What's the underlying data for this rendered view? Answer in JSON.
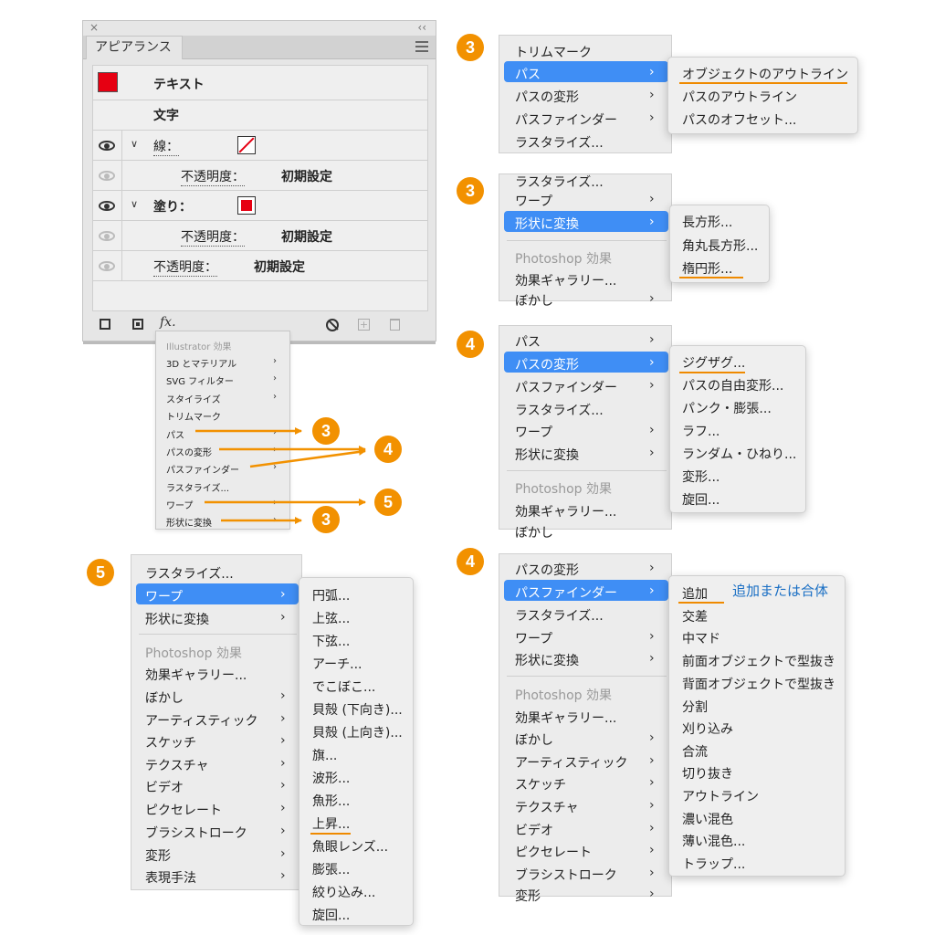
{
  "colors": {
    "accent": "#f29100",
    "highlight": "#3f8ef5",
    "swatch_red": "#e60012",
    "note_blue": "#1a6fc4"
  },
  "panel": {
    "close": "×",
    "collapse": "‹‹",
    "tab": "アピアランス",
    "rows": {
      "title": "テキスト",
      "sub": "文字",
      "stroke_label": "線：",
      "stroke_opacity_label": "不透明度：",
      "stroke_opacity_value": "初期設定",
      "fill_label": "塗り：",
      "fill_opacity_label": "不透明度：",
      "fill_opacity_value": "初期設定",
      "opacity_label": "不透明度：",
      "opacity_value": "初期設定"
    },
    "footer_fx": "fx."
  },
  "fx_menu": {
    "header": "Illustrator 効果",
    "items": [
      "3D とマテリアル",
      "SVG フィルター",
      "スタイライズ",
      "トリムマーク",
      "パス",
      "パスの変形",
      "パスファインダー",
      "ラスタライズ...",
      "ワープ",
      "形状に変換"
    ]
  },
  "badges": {
    "b1": "3",
    "b2": "4",
    "b3": "5",
    "b4": "3",
    "m1": "3",
    "m2": "3",
    "m3": "4",
    "m4": "5",
    "m5": "4"
  },
  "m1": {
    "items": [
      "トリムマーク",
      "パス",
      "パスの変形",
      "パスファインダー",
      "ラスタライズ..."
    ],
    "sub": [
      "オブジェクトのアウトライン",
      "パスのアウトライン",
      "パスのオフセット..."
    ]
  },
  "m2": {
    "items": [
      "ラスタライズ...",
      "ワープ",
      "形状に変換",
      "Photoshop 効果",
      "効果ギャラリー...",
      "ぼかし"
    ],
    "sub": [
      "長方形...",
      "角丸長方形...",
      "楕円形..."
    ]
  },
  "m3": {
    "items": [
      "パス",
      "パスの変形",
      "パスファインダー",
      "ラスタライズ...",
      "ワープ",
      "形状に変換",
      "Photoshop 効果",
      "効果ギャラリー...",
      "ぼかし"
    ],
    "sub": [
      "ジグザグ...",
      "パスの自由変形...",
      "パンク・膨張...",
      "ラフ...",
      "ランダム・ひねり...",
      "変形...",
      "旋回..."
    ]
  },
  "m4": {
    "items": [
      "ラスタライズ...",
      "ワープ",
      "形状に変換",
      "Photoshop 効果",
      "効果ギャラリー...",
      "ぼかし",
      "アーティスティック",
      "スケッチ",
      "テクスチャ",
      "ビデオ",
      "ピクセレート",
      "ブラシストローク",
      "変形",
      "表現手法"
    ],
    "sub": [
      "円弧...",
      "上弦...",
      "下弦...",
      "アーチ...",
      "でこぼこ...",
      "貝殻 (下向き)...",
      "貝殻 (上向き)...",
      "旗...",
      "波形...",
      "魚形...",
      "上昇...",
      "魚眼レンズ...",
      "膨張...",
      "絞り込み...",
      "旋回..."
    ]
  },
  "m5": {
    "items": [
      "パスの変形",
      "パスファインダー",
      "ラスタライズ...",
      "ワープ",
      "形状に変換",
      "Photoshop 効果",
      "効果ギャラリー...",
      "ぼかし",
      "アーティスティック",
      "スケッチ",
      "テクスチャ",
      "ビデオ",
      "ピクセレート",
      "ブラシストローク",
      "変形"
    ],
    "sub": [
      "追加",
      "交差",
      "中マド",
      "前面オブジェクトで型抜き",
      "背面オブジェクトで型抜き",
      "分割",
      "刈り込み",
      "合流",
      "切り抜き",
      "アウトライン",
      "濃い混色",
      "薄い混色...",
      "トラップ..."
    ],
    "note": "追加または合体"
  }
}
